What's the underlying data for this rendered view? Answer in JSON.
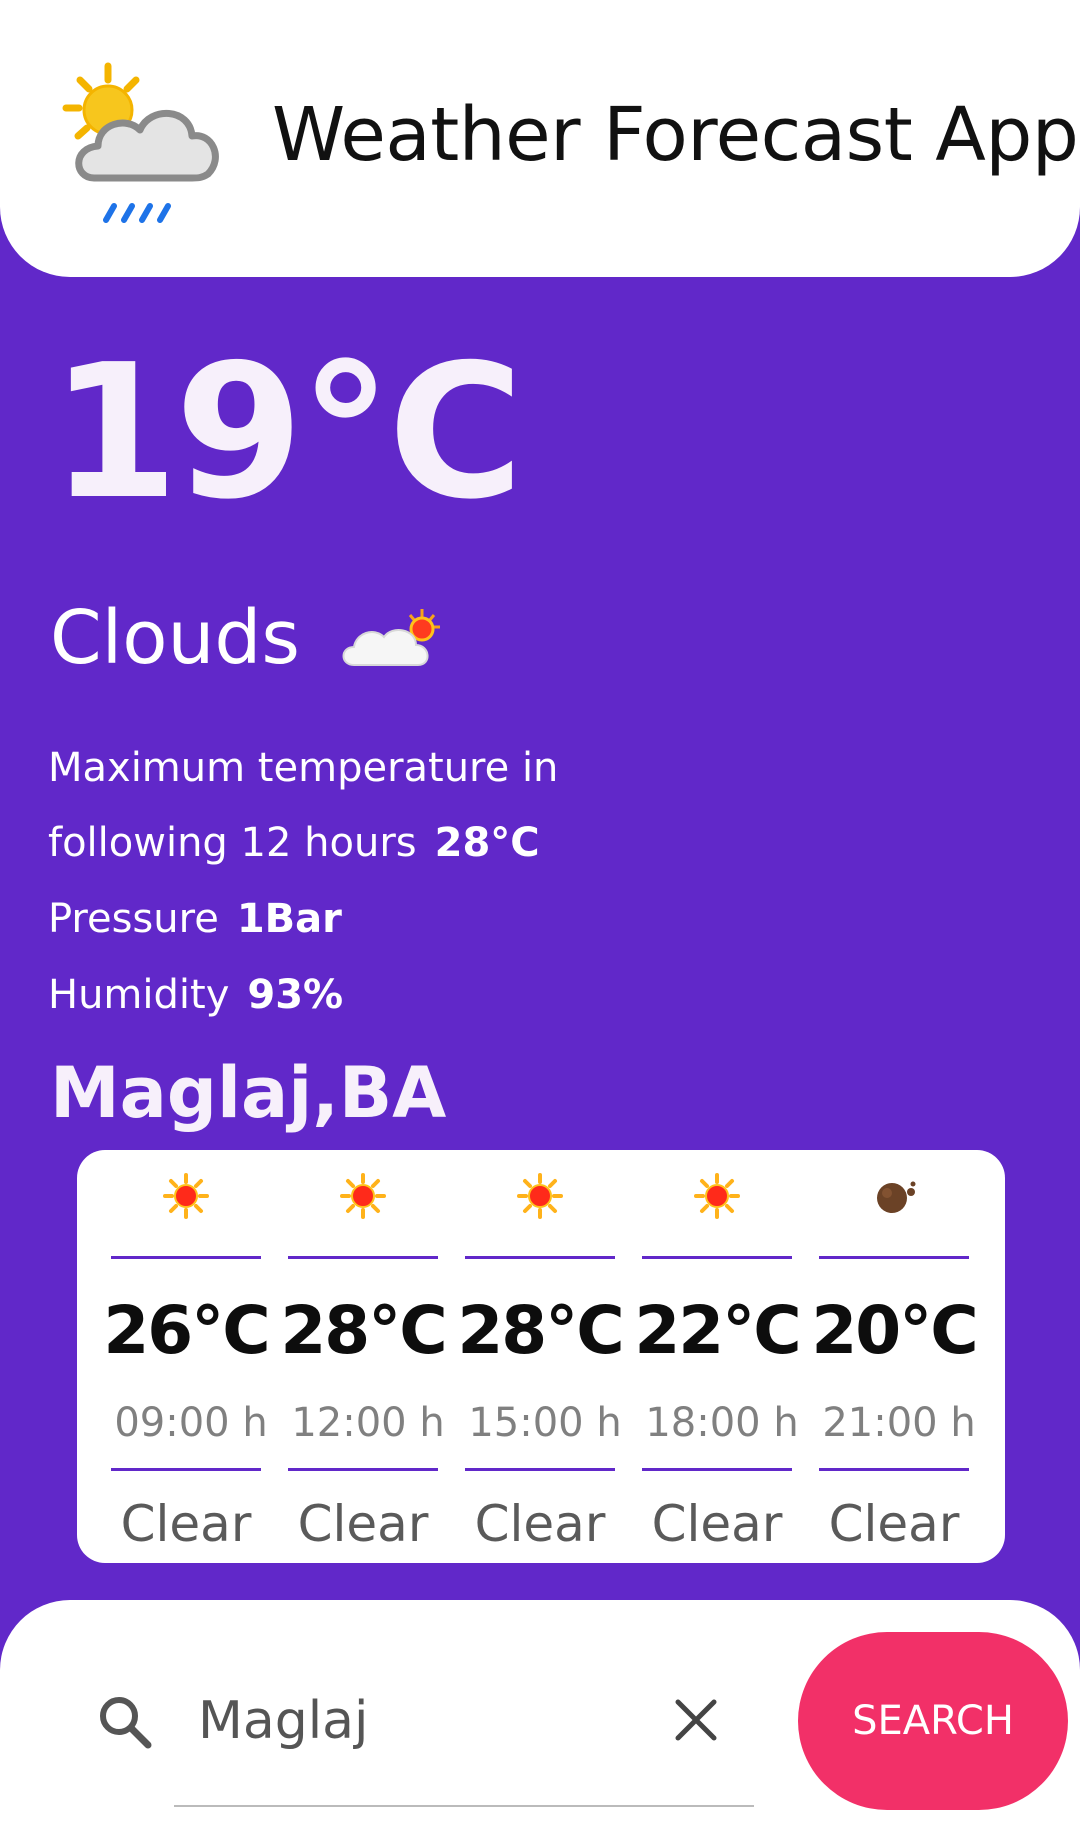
{
  "header": {
    "title": "Weather Forecast App",
    "logo_icon": "sun-cloud-rain-icon"
  },
  "current": {
    "temperature": "19°C",
    "condition": "Clouds",
    "condition_icon": "cloud-sun-icon",
    "max_temp_label_line1": "Maximum temperature in",
    "max_temp_label_line2": "following 12 hours",
    "max_temp_value": "28°C",
    "pressure_label": "Pressure",
    "pressure_value": "1Bar",
    "humidity_label": "Humidity",
    "humidity_value": "93%",
    "location": "Maglaj,BA"
  },
  "forecast": [
    {
      "icon": "sun-icon",
      "temp": "26°C",
      "time": "09:00 h",
      "desc": "Clear"
    },
    {
      "icon": "sun-icon",
      "temp": "28°C",
      "time": "12:00 h",
      "desc": "Clear"
    },
    {
      "icon": "sun-icon",
      "temp": "28°C",
      "time": "15:00 h",
      "desc": "Clear"
    },
    {
      "icon": "sun-icon",
      "temp": "22°C",
      "time": "18:00 h",
      "desc": "Clear"
    },
    {
      "icon": "moon-icon",
      "temp": "20°C",
      "time": "21:00 h",
      "desc": "Clear"
    }
  ],
  "search": {
    "value": "Maglaj",
    "button_label": "SEARCH"
  },
  "colors": {
    "background": "#6128c9",
    "accent": "#f23068",
    "card": "#ffffff"
  }
}
